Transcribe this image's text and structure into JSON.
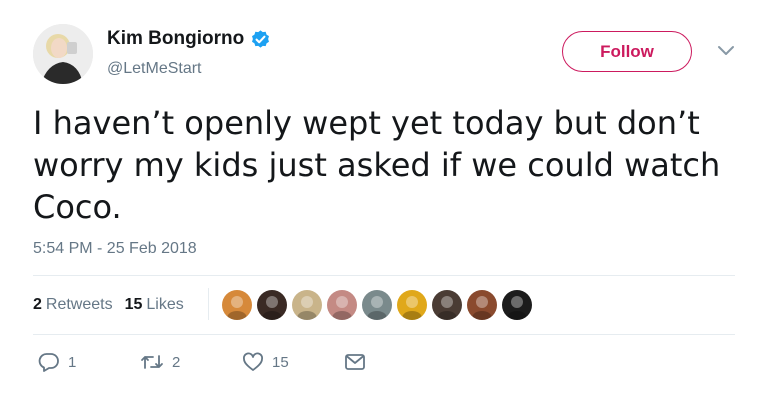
{
  "author": {
    "display_name": "Kim Bongiorno",
    "handle": "@LetMeStart",
    "verified": true
  },
  "follow_label": "Follow",
  "tweet": {
    "text": "I haven’t openly wept yet today but don’t worry my kids just asked if we could watch Coco.",
    "timestamp": "5:54 PM - 25 Feb 2018"
  },
  "stats": {
    "retweets_count": "2",
    "retweets_label": "Retweets",
    "likes_count": "15",
    "likes_label": "Likes"
  },
  "liker_avatars": [
    "#d6893a",
    "#3a2a24",
    "#c9b48a",
    "#c48a84",
    "#7a8a8c",
    "#e0a81a",
    "#4a3c34",
    "#8a4a2e",
    "#1c1c1c"
  ],
  "actions": {
    "reply_count": "1",
    "retweet_count": "2",
    "like_count": "15"
  },
  "colors": {
    "follow_accent": "#cc1a5e",
    "verified_blue": "#1da1f2",
    "secondary_text": "#657786"
  }
}
